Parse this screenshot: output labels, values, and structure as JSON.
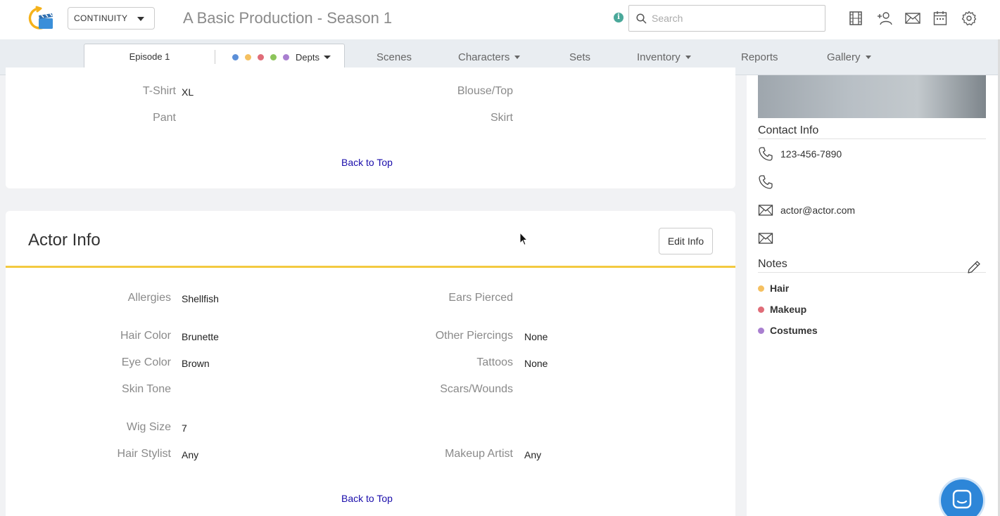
{
  "topbar": {
    "app_select": "CONTINUITY",
    "production_title": "A Basic Production - Season 1",
    "info_glyph": "i",
    "search_placeholder": "Search",
    "icons": [
      "film-icon",
      "add-user-icon",
      "mail-icon",
      "calendar-icon",
      "gear-icon"
    ]
  },
  "nav": {
    "episode": "Episode 1",
    "depts_label": "Depts",
    "dept_colors": [
      "#5b8fd8",
      "#f5c060",
      "#e06c78",
      "#8cc45a",
      "#a97fd0"
    ],
    "items": [
      {
        "label": "Scenes",
        "dropdown": false
      },
      {
        "label": "Characters",
        "dropdown": true
      },
      {
        "label": "Sets",
        "dropdown": false
      },
      {
        "label": "Inventory",
        "dropdown": true
      },
      {
        "label": "Reports",
        "dropdown": false
      },
      {
        "label": "Gallery",
        "dropdown": true
      }
    ]
  },
  "sizes_card": {
    "fields": [
      {
        "label": "T-Shirt",
        "value": "XL"
      },
      {
        "label": "Blouse/Top",
        "value": ""
      },
      {
        "label": "Pant",
        "value": ""
      },
      {
        "label": "Skirt",
        "value": ""
      }
    ],
    "back_to_top": "Back to Top"
  },
  "actor_card": {
    "title": "Actor Info",
    "edit_button": "Edit Info",
    "accent_color": "#f3c940",
    "fields": [
      {
        "label": "Allergies",
        "value": "Shellfish"
      },
      {
        "label": "Ears Pierced",
        "value": ""
      },
      {
        "label": "Hair Color",
        "value": "Brunette"
      },
      {
        "label": "Other Piercings",
        "value": "None"
      },
      {
        "label": "Eye Color",
        "value": "Brown"
      },
      {
        "label": "Tattoos",
        "value": "None"
      },
      {
        "label": "Skin Tone",
        "value": ""
      },
      {
        "label": "Scars/Wounds",
        "value": ""
      },
      {
        "label": "Wig Size",
        "value": "7"
      },
      {
        "label": "Hair Stylist",
        "value": "Any"
      },
      {
        "label": "Makeup Artist",
        "value": "Any"
      }
    ],
    "back_to_top": "Back to Top"
  },
  "right_panel": {
    "contact_heading": "Contact Info",
    "phone_1": "123-456-7890",
    "phone_2": "",
    "email_1": "actor@actor.com",
    "email_2": "",
    "notes_heading": "Notes",
    "notes": [
      {
        "label": "Hair",
        "color": "#f5c060"
      },
      {
        "label": "Makeup",
        "color": "#e06c78"
      },
      {
        "label": "Costumes",
        "color": "#a97fd0"
      }
    ]
  }
}
